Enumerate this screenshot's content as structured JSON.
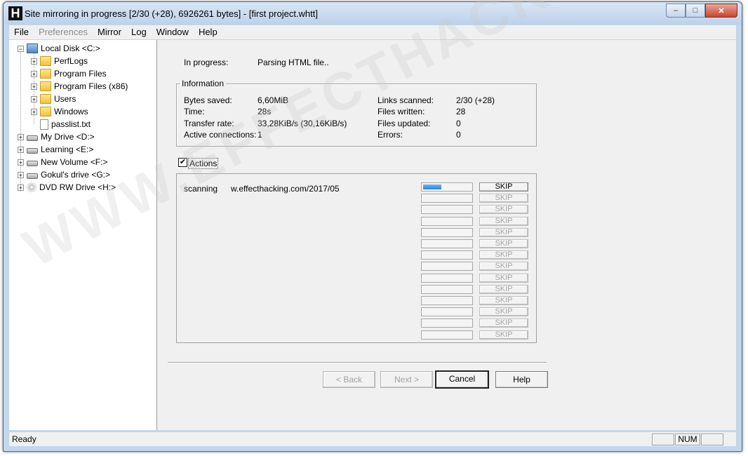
{
  "window": {
    "title": "Site mirroring in progress [2/30 (+28), 6926261 bytes] - [first project.whtt]",
    "app_icon_letter": "H"
  },
  "caption": {
    "minimize": "–",
    "maximize": "□",
    "close": "✕"
  },
  "menubar": [
    {
      "label": "File",
      "enabled": true
    },
    {
      "label": "Preferences",
      "enabled": false
    },
    {
      "label": "Mirror",
      "enabled": true
    },
    {
      "label": "Log",
      "enabled": true
    },
    {
      "label": "Window",
      "enabled": true
    },
    {
      "label": "Help",
      "enabled": true
    }
  ],
  "tree": {
    "local_disk": "Local Disk <C:>",
    "perflogs": "PerfLogs",
    "program_files": "Program Files",
    "program_files_x86": "Program Files (x86)",
    "users": "Users",
    "windows": "Windows",
    "passlist": "passlist.txt",
    "my_drive": "My Drive <D:>",
    "learning": "Learning <E:>",
    "new_volume": "New Volume <F:>",
    "gokul_drive": "Gokul's drive <G:>",
    "dvd_drive": "DVD RW Drive <H:>",
    "expand_glyph": "+",
    "collapse_glyph": "−"
  },
  "progress": {
    "label": "In progress:",
    "value": "Parsing HTML file.."
  },
  "information": {
    "title": "Information",
    "bytes_saved_label": "Bytes saved:",
    "bytes_saved": "6,60MiB",
    "time_label": "Time:",
    "time": "28s",
    "transfer_rate_label": "Transfer rate:",
    "transfer_rate": "33,28KiB/s (30,16KiB/s)",
    "active_connections_label": "Active connections:",
    "active_connections": "1",
    "links_scanned_label": "Links scanned:",
    "links_scanned": "2/30 (+28)",
    "files_written_label": "Files written:",
    "files_written": "28",
    "files_updated_label": "Files updated:",
    "files_updated": "0",
    "errors_label": "Errors:",
    "errors": "0"
  },
  "actions": {
    "checkbox_label": "Actions",
    "checked": true,
    "check_glyph": "✔",
    "rows": [
      {
        "status": "scanning",
        "url": "w.effecthacking.com/2017/05",
        "progress": 0.38,
        "skip": "SKIP",
        "enabled": true
      },
      {
        "status": "",
        "url": "",
        "progress": 0,
        "skip": "SKIP",
        "enabled": false
      },
      {
        "status": "",
        "url": "",
        "progress": 0,
        "skip": "SKIP",
        "enabled": false
      },
      {
        "status": "",
        "url": "",
        "progress": 0,
        "skip": "SKIP",
        "enabled": false
      },
      {
        "status": "",
        "url": "",
        "progress": 0,
        "skip": "SKIP",
        "enabled": false
      },
      {
        "status": "",
        "url": "",
        "progress": 0,
        "skip": "SKIP",
        "enabled": false
      },
      {
        "status": "",
        "url": "",
        "progress": 0,
        "skip": "SKIP",
        "enabled": false
      },
      {
        "status": "",
        "url": "",
        "progress": 0,
        "skip": "SKIP",
        "enabled": false
      },
      {
        "status": "",
        "url": "",
        "progress": 0,
        "skip": "SKIP",
        "enabled": false
      },
      {
        "status": "",
        "url": "",
        "progress": 0,
        "skip": "SKIP",
        "enabled": false
      },
      {
        "status": "",
        "url": "",
        "progress": 0,
        "skip": "SKIP",
        "enabled": false
      },
      {
        "status": "",
        "url": "",
        "progress": 0,
        "skip": "SKIP",
        "enabled": false
      },
      {
        "status": "",
        "url": "",
        "progress": 0,
        "skip": "SKIP",
        "enabled": false
      },
      {
        "status": "",
        "url": "",
        "progress": 0,
        "skip": "SKIP",
        "enabled": false
      }
    ]
  },
  "wizard": {
    "back": "< Back",
    "next": "Next >",
    "cancel": "Cancel",
    "help": "Help"
  },
  "status_bar": {
    "text": "Ready",
    "num": "NUM"
  },
  "watermark": "WWW.EFFECTHACKING.COM",
  "colors": {
    "accent": "#2a82d8",
    "window_frame": "#c2d7ec",
    "face": "#f0f0f0"
  }
}
